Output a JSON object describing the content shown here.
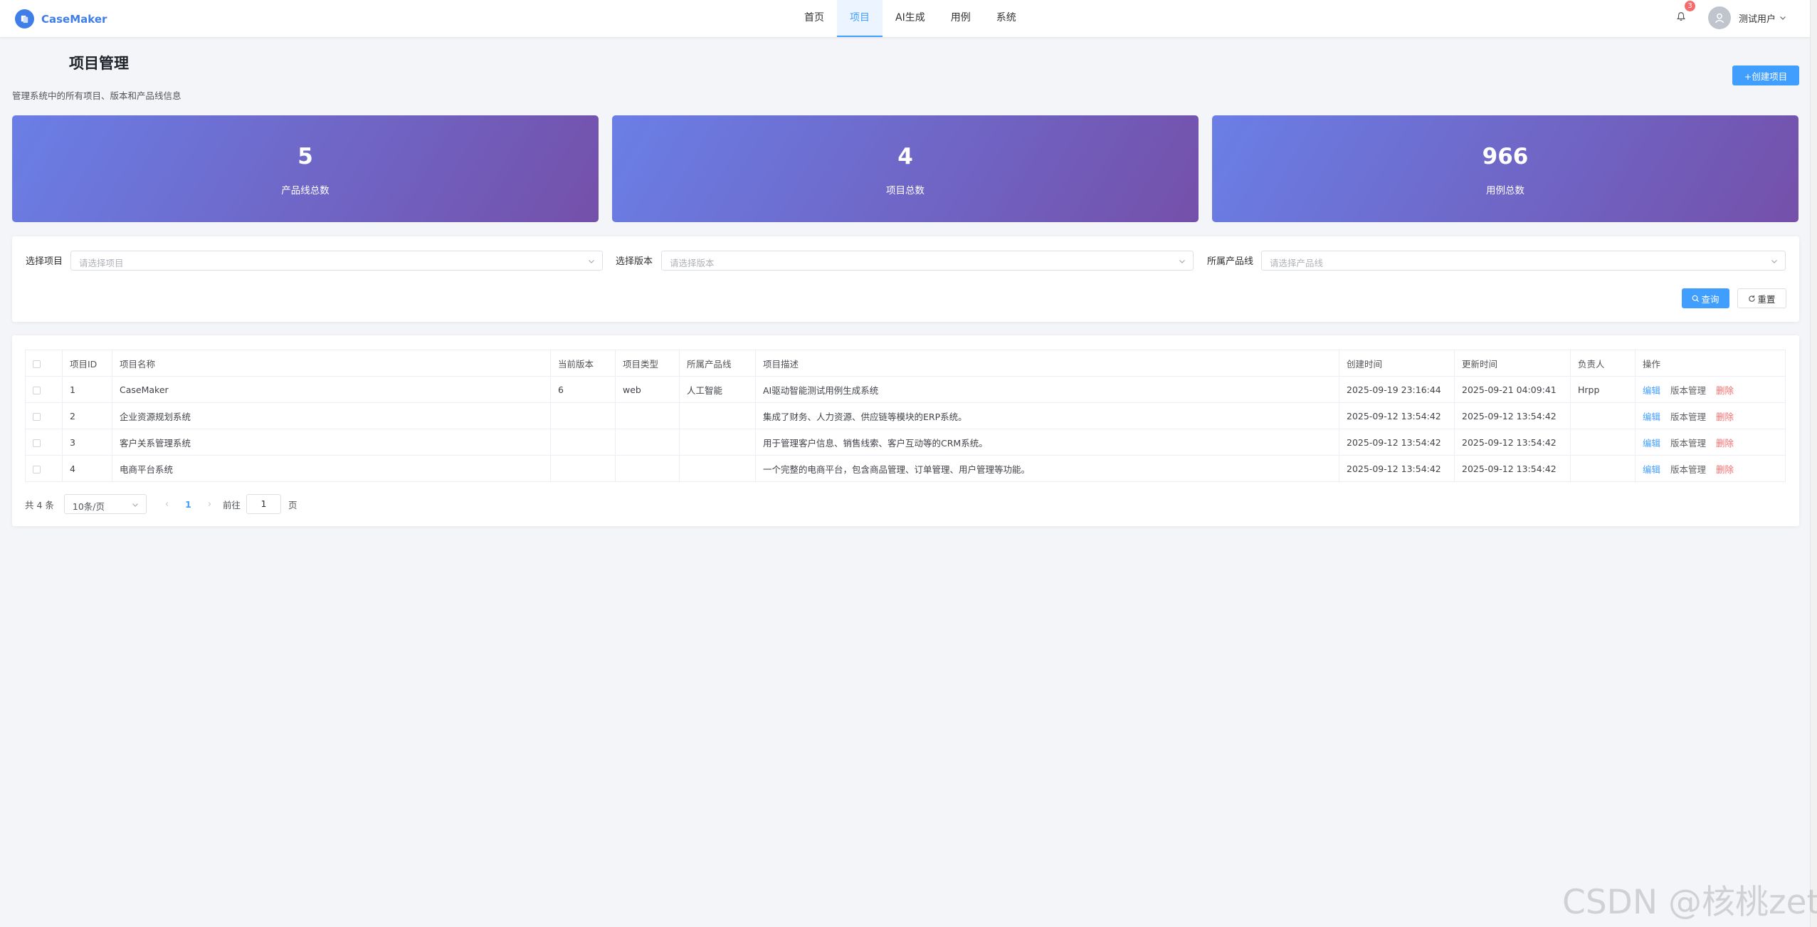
{
  "app": {
    "name": "CaseMaker"
  },
  "nav": [
    {
      "label": "首页",
      "active": false
    },
    {
      "label": "项目",
      "active": true
    },
    {
      "label": "AI生成",
      "active": false
    },
    {
      "label": "用例",
      "active": false
    },
    {
      "label": "系统",
      "active": false
    }
  ],
  "notifications": {
    "count": "3"
  },
  "user": {
    "name": "测试用户"
  },
  "page": {
    "title": "项目管理",
    "subtitle": "管理系统中的所有项目、版本和产品线信息",
    "create_button": "+创建项目"
  },
  "stats": [
    {
      "value": "5",
      "label": "产品线总数"
    },
    {
      "value": "4",
      "label": "项目总数"
    },
    {
      "value": "966",
      "label": "用例总数"
    }
  ],
  "filters": {
    "project": {
      "label": "选择项目",
      "placeholder": "请选择项目"
    },
    "version": {
      "label": "选择版本",
      "placeholder": "请选择版本"
    },
    "product_line": {
      "label": "所属产品线",
      "placeholder": "请选择产品线"
    },
    "query_button": "查询",
    "reset_button": "重置"
  },
  "table": {
    "columns": [
      "项目ID",
      "项目名称",
      "当前版本",
      "项目类型",
      "所属产品线",
      "项目描述",
      "创建时间",
      "更新时间",
      "负责人",
      "操作"
    ],
    "rows": [
      {
        "id": "1",
        "name": "CaseMaker",
        "version": "6",
        "type": "web",
        "product_line": "人工智能",
        "description": "AI驱动智能测试用例生成系统",
        "created": "2025-09-19 23:16:44",
        "updated": "2025-09-21 04:09:41",
        "owner": "Hrpp"
      },
      {
        "id": "2",
        "name": "企业资源规划系统",
        "version": "",
        "type": "",
        "product_line": "",
        "description": "集成了财务、人力资源、供应链等模块的ERP系统。",
        "created": "2025-09-12 13:54:42",
        "updated": "2025-09-12 13:54:42",
        "owner": ""
      },
      {
        "id": "3",
        "name": "客户关系管理系统",
        "version": "",
        "type": "",
        "product_line": "",
        "description": "用于管理客户信息、销售线索、客户互动等的CRM系统。",
        "created": "2025-09-12 13:54:42",
        "updated": "2025-09-12 13:54:42",
        "owner": ""
      },
      {
        "id": "4",
        "name": "电商平台系统",
        "version": "",
        "type": "",
        "product_line": "",
        "description": "一个完整的电商平台，包含商品管理、订单管理、用户管理等功能。",
        "created": "2025-09-12 13:54:42",
        "updated": "2025-09-12 13:54:42",
        "owner": ""
      }
    ],
    "actions": {
      "edit": "编辑",
      "version_manage": "版本管理",
      "delete": "删除"
    }
  },
  "pagination": {
    "total": "共 4 条",
    "page_size": "10条/页",
    "current_page": "1",
    "goto_label": "前往",
    "goto_value": "1",
    "page_unit": "页"
  },
  "watermark": "CSDN @核桃zet",
  "colors": {
    "primary": "#409eff",
    "danger": "#f56c6c",
    "card_gradient_start": "#6a7fe6",
    "card_gradient_end": "#7450aa"
  }
}
